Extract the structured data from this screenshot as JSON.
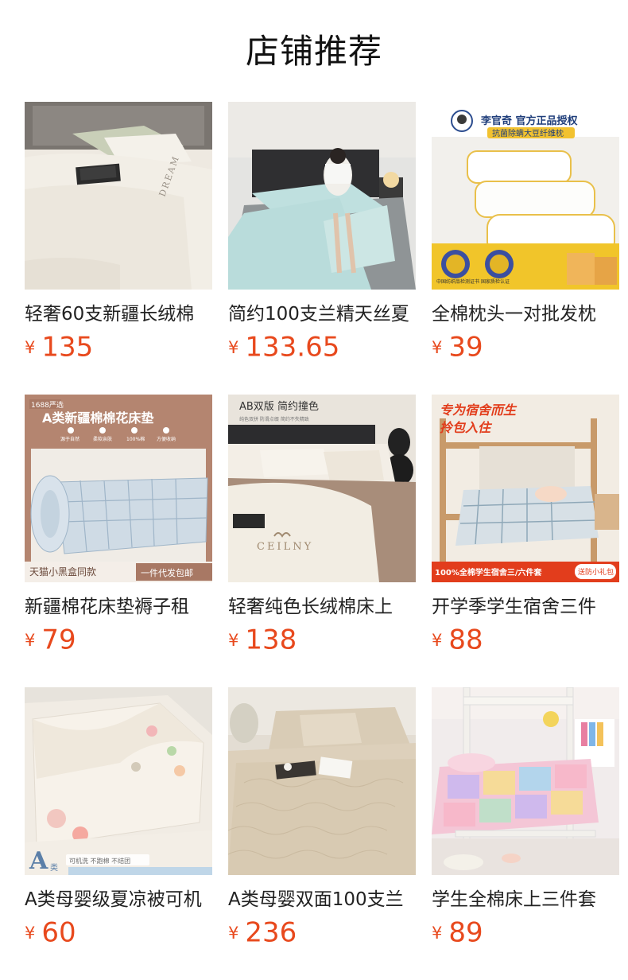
{
  "section": {
    "title": "店铺推荐"
  },
  "currency_symbol": "¥",
  "products": [
    {
      "name": "轻奢60支新疆长绒棉",
      "price": "135",
      "image_text": {
        "embroidery": "DREAM"
      }
    },
    {
      "name": "简约100支兰精天丝夏",
      "price": "133.65",
      "image_text": {}
    },
    {
      "name": "全棉枕头一对批发枕",
      "price": "39",
      "image_text": {
        "brand_header": "李官奇 官方正品授权",
        "subtitle": "抗菌除螨大豆纤维枕",
        "badge_left": "中国纺织品检测证书",
        "badge_right": "国家质检认证"
      }
    },
    {
      "name": "新疆棉花床垫褥子租",
      "price": "79",
      "image_text": {
        "tag": "1688严选",
        "headline": "A类新疆棉棉花床垫",
        "features": [
          "源于自然",
          "柔软亲肤",
          "100%棉",
          "方便收纳"
        ],
        "bottom_left": "天猫小黑盒同款",
        "bottom_right": "一件代发包邮"
      }
    },
    {
      "name": "轻奢纯色长绒棉床上",
      "price": "138",
      "image_text": {
        "headline": "AB双版 简约撞色",
        "sub": "纯色双拼 防滑点缀 简约不失精致",
        "embroidery": "CEILNY"
      }
    },
    {
      "name": "开学季学生宿舍三件",
      "price": "88",
      "image_text": {
        "headline_1": "专为宿舍而生",
        "headline_2": "拎包入住",
        "bottom": "100%全棉学生宿舍三/六件套",
        "bottom_badge": "送防小礼包"
      }
    },
    {
      "name": "A类母婴级夏凉被可机",
      "price": "60",
      "image_text": {
        "badge_big": "A",
        "badge_small": "类",
        "caption": "可机洗 不跑棉 不结团"
      }
    },
    {
      "name": "A类母婴双面100支兰",
      "price": "236",
      "image_text": {}
    },
    {
      "name": "学生全棉床上三件套",
      "price": "89",
      "image_text": {}
    }
  ],
  "colors": {
    "price": "#e8491d",
    "title": "#111111",
    "name": "#222222"
  }
}
